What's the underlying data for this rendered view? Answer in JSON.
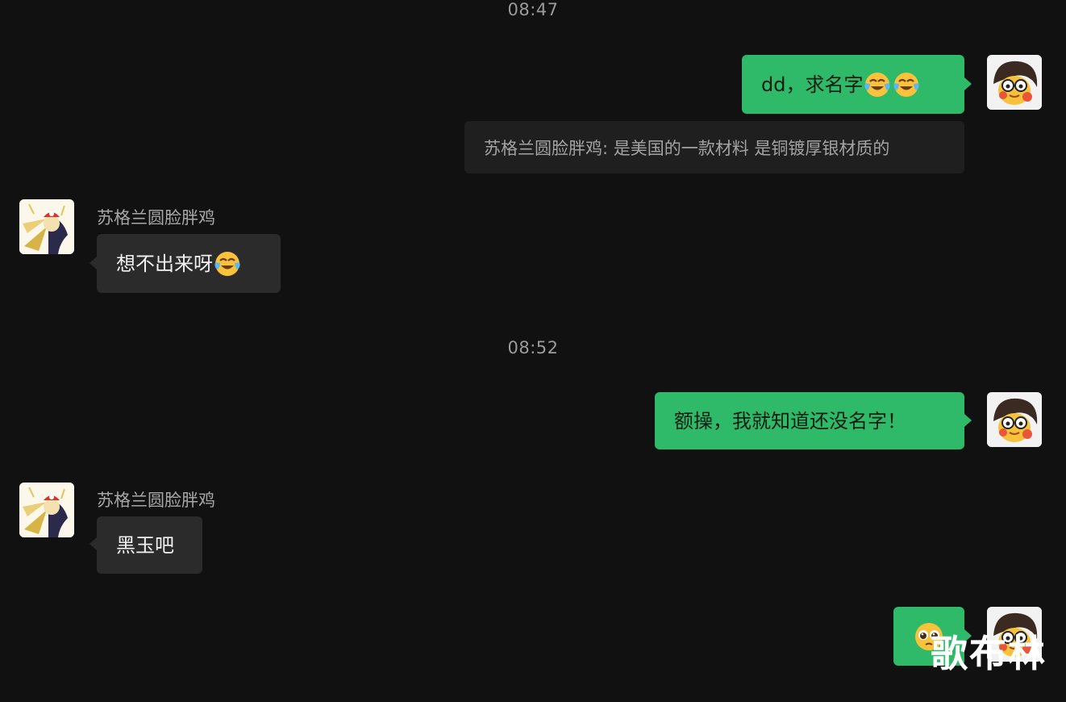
{
  "timestamps": [
    "08:47",
    "08:52"
  ],
  "messages": {
    "m1": {
      "text": "dd，求名字",
      "emojis": [
        "crying-laughing-emoji",
        "crying-laughing-emoji"
      ]
    },
    "m1_quote": "苏格兰圆脸胖鸡: 是美国的一款材料 是铜镀厚银材质的",
    "m2": {
      "sender": "苏格兰圆脸胖鸡",
      "text": "想不出来呀",
      "emojis": [
        "crying-laughing-emoji"
      ]
    },
    "m3": {
      "text": "额操，我就知道还没名字！"
    },
    "m4": {
      "sender": "苏格兰圆脸胖鸡",
      "text": "黑玉吧"
    },
    "m5": {
      "emojis": [
        "pleading-face-emoji"
      ]
    }
  },
  "watermark": "歌布林",
  "colors": {
    "background": "#111111",
    "outgoing_bubble": "#2fba69",
    "incoming_bubble": "#2b2b2b",
    "quote_bubble": "#1f1f1f"
  }
}
